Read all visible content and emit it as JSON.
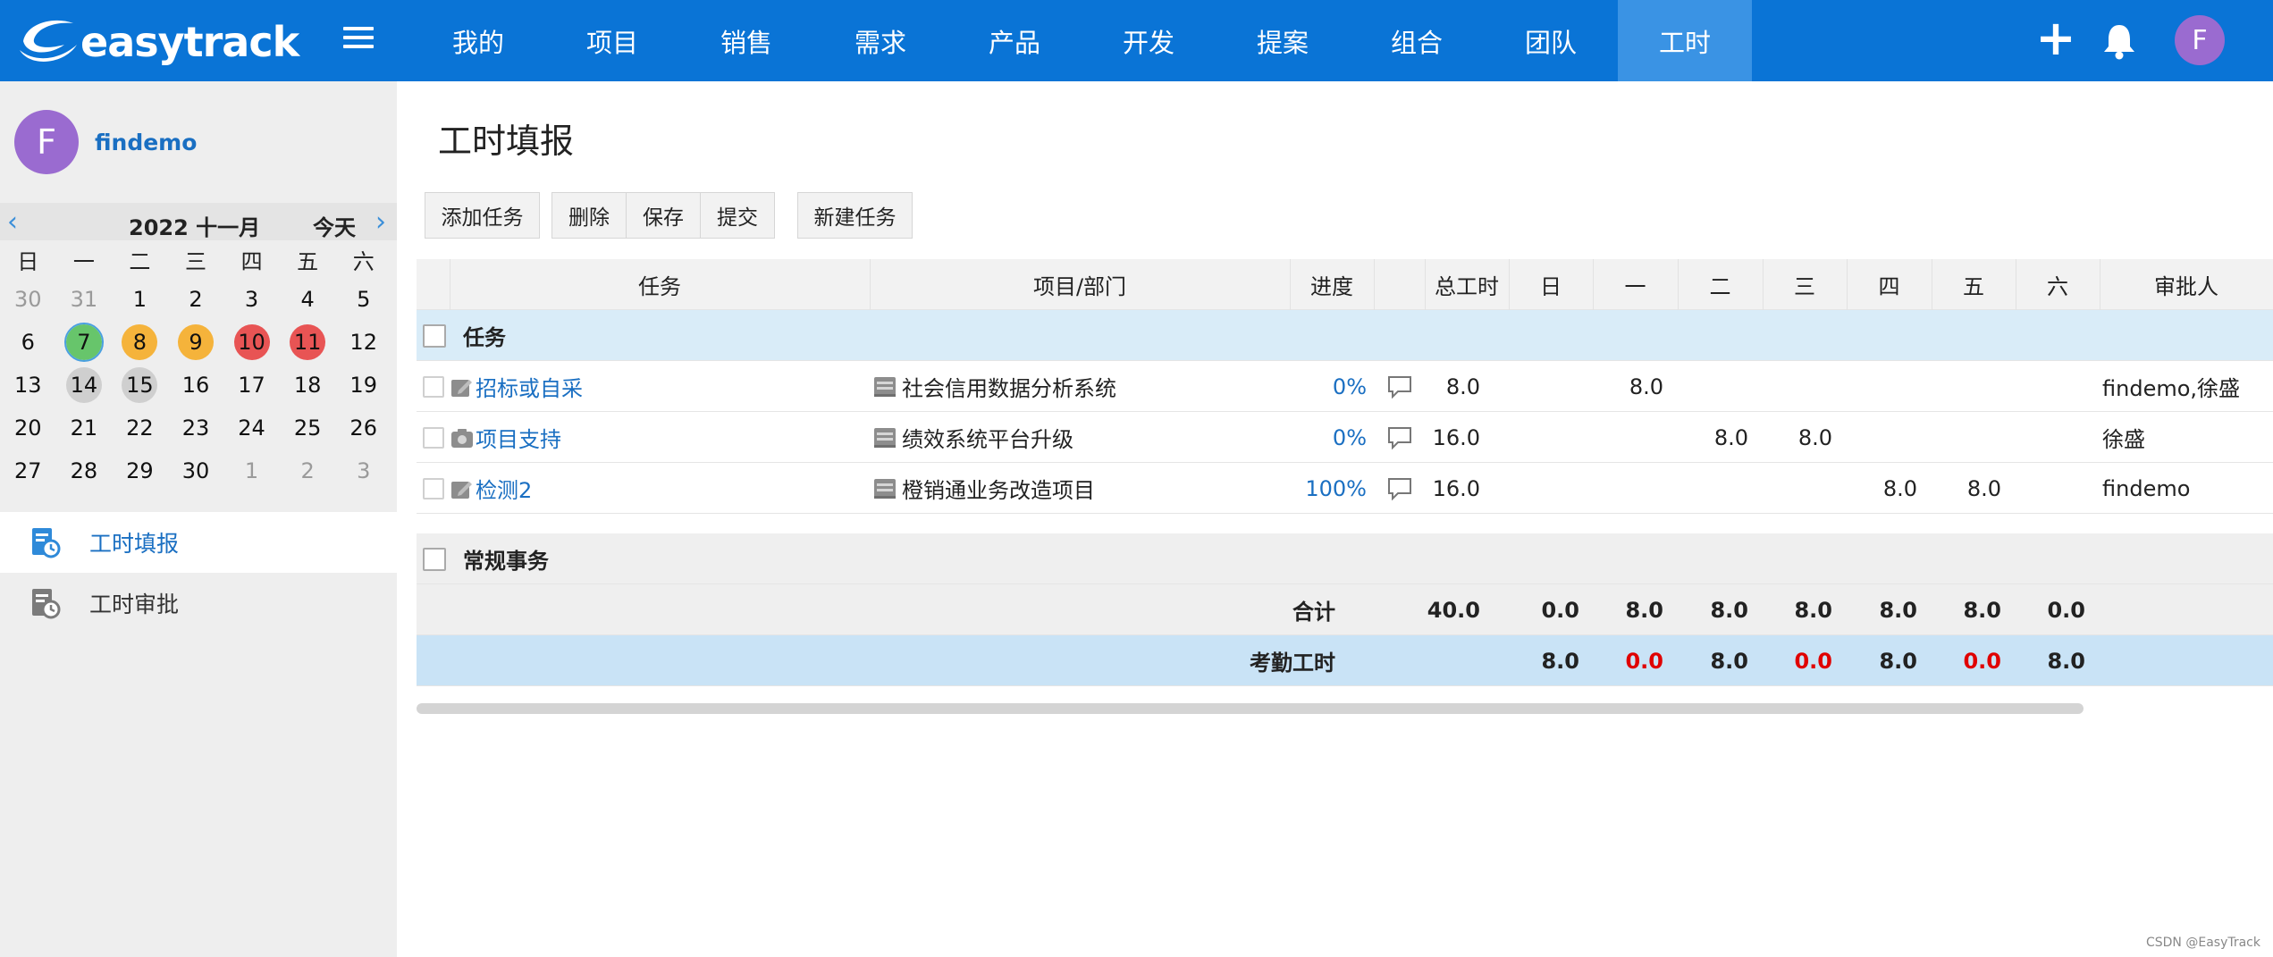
{
  "app": {
    "logo_text": "easytrack"
  },
  "nav": {
    "items": [
      "我的",
      "项目",
      "销售",
      "需求",
      "产品",
      "开发",
      "提案",
      "组合",
      "团队",
      "工时"
    ],
    "active_index": 9
  },
  "topbar": {
    "plus_icon": "plus-icon",
    "bell_icon": "bell-icon",
    "avatar_letter": "F"
  },
  "sidebar": {
    "user": {
      "avatar_letter": "F",
      "name": "findemo"
    },
    "calendar": {
      "title": "2022 十一月",
      "today_label": "今天",
      "weekdays": [
        "日",
        "一",
        "二",
        "三",
        "四",
        "五",
        "六"
      ],
      "weeks": [
        [
          "30",
          "31",
          "1",
          "2",
          "3",
          "4",
          "5"
        ],
        [
          "6",
          "7",
          "8",
          "9",
          "10",
          "11",
          "12"
        ],
        [
          "13",
          "14",
          "15",
          "16",
          "17",
          "18",
          "19"
        ],
        [
          "20",
          "21",
          "22",
          "23",
          "24",
          "25",
          "26"
        ],
        [
          "27",
          "28",
          "29",
          "30",
          "1",
          "2",
          "3"
        ]
      ]
    },
    "menu": [
      {
        "label": "工时填报",
        "icon": "timesheet-icon"
      },
      {
        "label": "工时审批",
        "icon": "approval-icon"
      }
    ]
  },
  "main": {
    "title": "工时填报",
    "toolbar": {
      "add_task": "添加任务",
      "delete": "删除",
      "save": "保存",
      "submit": "提交",
      "new_task": "新建任务"
    },
    "columns": {
      "task": "任务",
      "project": "项目/部门",
      "progress": "进度",
      "total": "总工时",
      "sun": "日",
      "mon": "一",
      "tue": "二",
      "wed": "三",
      "thu": "四",
      "fri": "五",
      "sat": "六",
      "approver": "审批人"
    },
    "group_tasks": "任务",
    "rows": [
      {
        "task": "招标或自采",
        "project": "社会信用数据分析系统",
        "progress": "0%",
        "total": "8.0",
        "days": [
          "",
          "8.0",
          "",
          "",
          "",
          "",
          ""
        ],
        "approver": "findemo,徐盛"
      },
      {
        "task": "项目支持",
        "project": "绩效系统平台升级",
        "progress": "0%",
        "total": "16.0",
        "days": [
          "",
          "",
          "8.0",
          "8.0",
          "",
          "",
          ""
        ],
        "approver": "徐盛"
      },
      {
        "task": "检测2",
        "project": "橙销通业务改造项目",
        "progress": "100%",
        "total": "16.0",
        "days": [
          "",
          "",
          "",
          "",
          "8.0",
          "8.0",
          ""
        ],
        "approver": "findemo"
      }
    ],
    "group_routine": "常规事务",
    "total_row": {
      "label": "合计",
      "total": "40.0",
      "days": [
        "0.0",
        "8.0",
        "8.0",
        "8.0",
        "8.0",
        "8.0",
        "0.0"
      ]
    },
    "attendance_row": {
      "label": "考勤工时",
      "days": [
        "8.0",
        "0.0",
        "8.0",
        "0.0",
        "8.0",
        "0.0",
        "8.0"
      ]
    }
  },
  "watermark": "CSDN @EasyTrack",
  "colors": {
    "topbar": "#0a74d6",
    "accent": "#1a6fc2",
    "red": "#e00000"
  }
}
